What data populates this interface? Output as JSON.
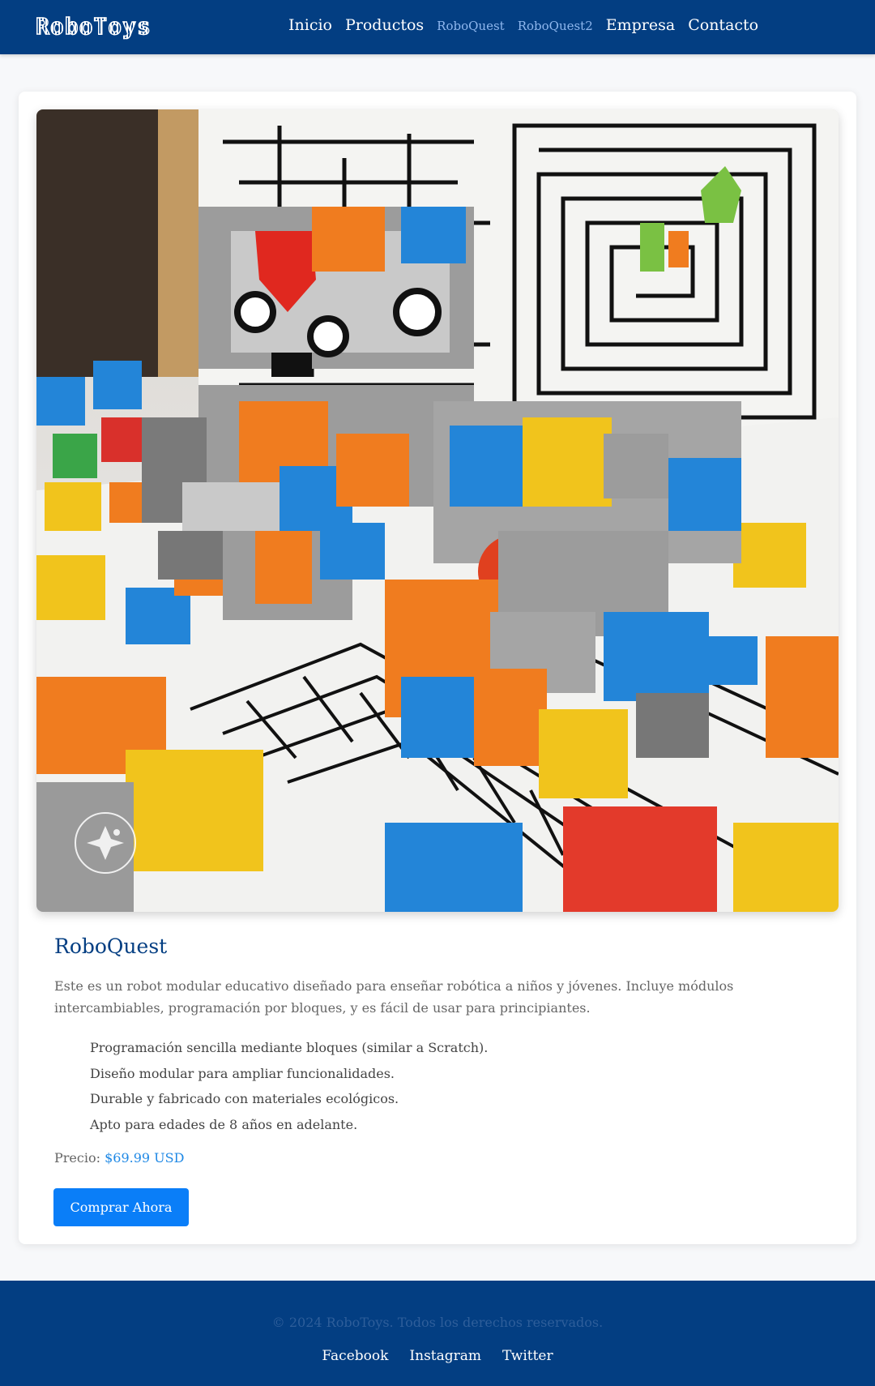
{
  "header": {
    "brand": "RoboToys",
    "nav": [
      {
        "label": "Inicio"
      },
      {
        "label": "Productos"
      },
      {
        "label": "RoboQuest"
      },
      {
        "label": "RoboQuest2"
      },
      {
        "label": "Empresa"
      },
      {
        "label": "Contacto"
      }
    ]
  },
  "product": {
    "image_alt": "RoboQuest robot modular",
    "title": "RoboQuest",
    "description": "Este es un robot modular educativo diseñado para enseñar robótica a niños y jóvenes. Incluye módulos intercambiables, programación por bloques, y es fácil de usar para principiantes.",
    "features": [
      "Programación sencilla mediante bloques (similar a Scratch).",
      "Diseño modular para ampliar funcionalidades.",
      "Durable y fabricado con materiales ecológicos.",
      "Apto para edades de 8 años en adelante."
    ],
    "price_label": "Precio:",
    "price_value": "$69.99 USD",
    "buy_button": "Comprar Ahora",
    "watermark": "IMAGINED WITH AI"
  },
  "footer": {
    "copyright": "© 2024 RoboToys. Todos los derechos reservados.",
    "social": [
      {
        "label": "Facebook"
      },
      {
        "label": "Instagram"
      },
      {
        "label": "Twitter"
      }
    ]
  },
  "colors": {
    "nav_bg": "#033e82",
    "accent": "#0a7ef8",
    "price": "#1e88e5",
    "title": "#033e82"
  }
}
